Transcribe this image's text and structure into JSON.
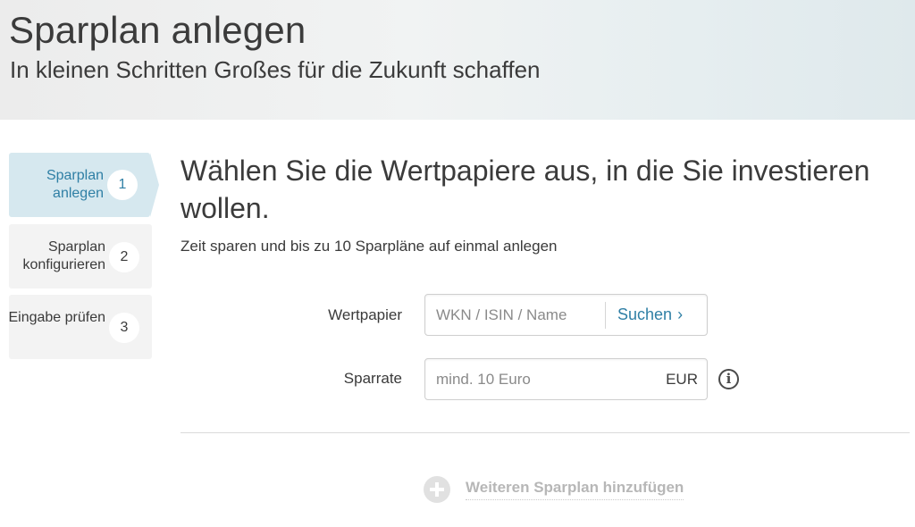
{
  "header": {
    "title": "Sparplan anlegen",
    "subtitle": "In kleinen Schritten Großes für die Zukunft schaffen"
  },
  "steps": [
    {
      "label": "Sparplan anlegen",
      "number": "1",
      "active": true
    },
    {
      "label": "Sparplan konfigurieren",
      "number": "2",
      "active": false
    },
    {
      "label": "Eingabe prüfen",
      "number": "3",
      "active": false
    }
  ],
  "main": {
    "heading": "Wählen Sie die Wertpapiere aus, in die Sie investieren wollen.",
    "hint": "Zeit sparen und bis zu 10 Sparpläne auf einmal anlegen"
  },
  "form": {
    "wertpapier": {
      "label": "Wertpapier",
      "placeholder": "WKN / ISIN / Name",
      "value": "",
      "search_label": "Suchen",
      "search_icon": "chevron-right-icon"
    },
    "sparrate": {
      "label": "Sparrate",
      "placeholder": "mind. 10 Euro",
      "value": "",
      "currency": "EUR",
      "info_icon": "info-icon"
    }
  },
  "add_plan": {
    "label": "Weiteren Sparplan hinzufügen",
    "icon": "plus-circle-icon"
  },
  "colors": {
    "accent": "#2f7fa5",
    "active_step_bg": "#d6e8ef",
    "step_bg": "#f3f3f3",
    "disabled_text": "#b7b7b7"
  }
}
